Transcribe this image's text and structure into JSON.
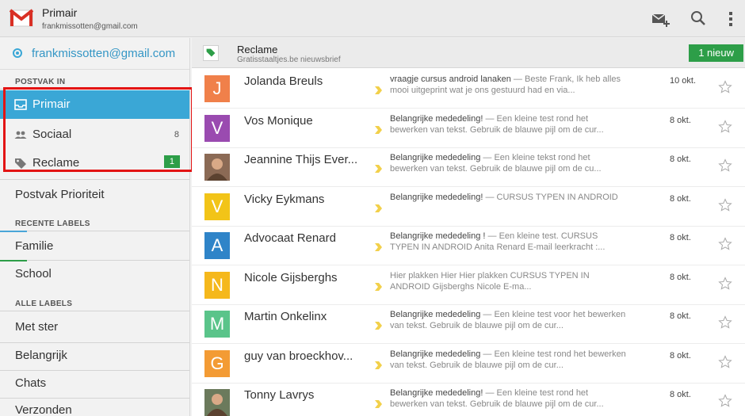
{
  "topbar": {
    "title": "Primair",
    "account": "frankmissotten@gmail.com"
  },
  "sidebar": {
    "account_email": "frankmissotten@gmail.com",
    "section_inbox": "POSTVAK IN",
    "inbox_items": [
      {
        "label": "Primair",
        "count": ""
      },
      {
        "label": "Sociaal",
        "count": "8"
      },
      {
        "label": "Reclame",
        "count": "1"
      }
    ],
    "priority": "Postvak Prioriteit",
    "section_recent": "RECENTE LABELS",
    "recent_labels": [
      {
        "label": "Familie",
        "color": "#4aa6d8"
      },
      {
        "label": "School",
        "color": "#2d9e48"
      }
    ],
    "section_all": "ALLE LABELS",
    "all_labels": [
      "Met ster",
      "Belangrijk",
      "Chats",
      "Verzonden"
    ]
  },
  "main": {
    "title": "Reclame",
    "subtitle": "Gratisstaaltjes.be nieuwsbrief",
    "new_badge": "1 nieuw"
  },
  "emails": [
    {
      "initial": "J",
      "avatar_color": "#f0804a",
      "sender": "Jolanda Breuls",
      "subject": "vraagje cursus android lanaken",
      "snippet": " — Beste Frank, Ik heb alles mooi uitgeprint wat je ons gestuurd had en via...",
      "date": "10 okt."
    },
    {
      "initial": "V",
      "avatar_color": "#9a4bb0",
      "sender": "Vos Monique",
      "subject": "Belangrijke mededeling!",
      "snippet": " — Een kleine test rond het bewerken van tekst. Gebruik de blauwe pijl om de cur...",
      "date": "8 okt."
    },
    {
      "initial": "",
      "avatar_color": "#8b6a55",
      "sender": "Jeannine Thijs Ever...",
      "subject": "Belangrijke mededeling",
      "snippet": " — Een kleine tekst rond het bewerken van tekst. Gebruik de blauwe pijl om de cu...",
      "date": "8 okt."
    },
    {
      "initial": "V",
      "avatar_color": "#f2c418",
      "sender": "Vicky Eykmans",
      "subject": "Belangrijke mededeling!",
      "snippet": " — CURSUS TYPEN IN ANDROID",
      "date": "8 okt."
    },
    {
      "initial": "A",
      "avatar_color": "#2f84c8",
      "sender": "Advocaat Renard",
      "subject": "Belangrijke mededeling !",
      "snippet": " — Een kleine test. CURSUS TYPEN IN ANDROID Anita Renard E-mail leerkracht :...",
      "date": "8 okt."
    },
    {
      "initial": "N",
      "avatar_color": "#f5b81c",
      "sender": "Nicole Gijsberghs",
      "subject": "",
      "snippet": "Hier plakken Hier Hier plakken CURSUS TYPEN IN ANDROID Gijsberghs Nicole E-ma...",
      "date": "8 okt."
    },
    {
      "initial": "M",
      "avatar_color": "#5ac48a",
      "sender": "Martin Onkelinx",
      "subject": "Belangrijke mededeling",
      "snippet": " — Een kleine test voor het bewerken van tekst. Gebruik de blauwe pijl om de cur...",
      "date": "8 okt."
    },
    {
      "initial": "G",
      "avatar_color": "#f39b34",
      "sender": "guy van broeckhov...",
      "subject": "Belangrijke mededeling",
      "snippet": " — Een kleine test rond het bewerken van tekst. Gebruik de blauwe pijl om de cur...",
      "date": "8 okt."
    },
    {
      "initial": "",
      "avatar_color": "#6b7a5c",
      "sender": "Tonny Lavrys",
      "subject": "Belangrijke mededeling!",
      "snippet": " — Een kleine test rond het bewerken van tekst. Gebruik de blauwe pijl om de cur...",
      "date": "8 okt."
    }
  ]
}
